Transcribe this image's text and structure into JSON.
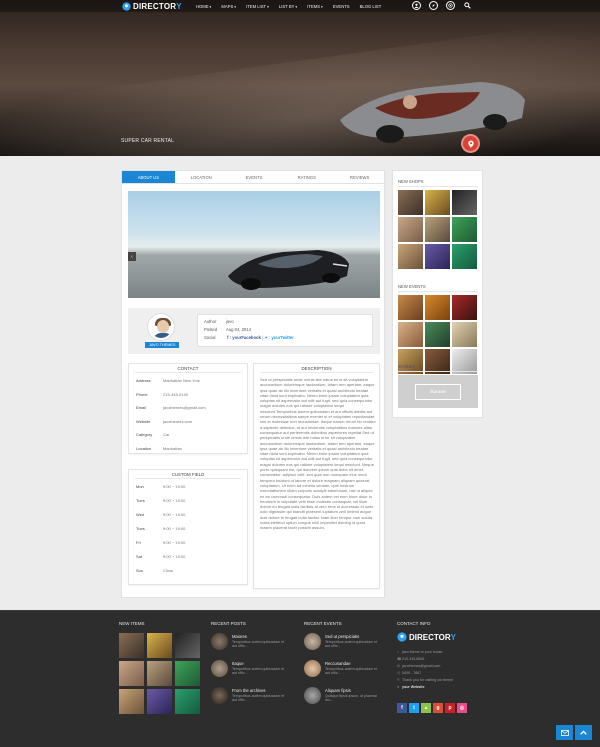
{
  "brand": {
    "name_main": "DIRECTOR",
    "name_accent": "Y"
  },
  "nav": [
    {
      "label": "HOME",
      "dropdown": true
    },
    {
      "label": "MAPS",
      "dropdown": true
    },
    {
      "label": "ITEM LIST",
      "dropdown": true
    },
    {
      "label": "LIST BY",
      "dropdown": true
    },
    {
      "label": "ITEMS",
      "dropdown": true
    },
    {
      "label": "EVENTS",
      "dropdown": false
    },
    {
      "label": "BLOG LIST",
      "dropdown": false
    }
  ],
  "hero": {
    "title": "SUPER CAR RENTAL"
  },
  "tabs": [
    "ABOUT US",
    "LOCATION",
    "EVENTS",
    "RATINGS",
    "REVIEWS"
  ],
  "author": {
    "badge": "JAVO THEMES",
    "rows": [
      {
        "k": "Author",
        "v": "javo"
      },
      {
        "k": "Posted",
        "v": "Aug 04, 2014"
      }
    ],
    "social_label": "Social",
    "facebook": "f : yourFacebook",
    "twitter": "yourTwitter",
    "twitter_prefix": " : "
  },
  "contact": {
    "title": "CONTACT",
    "rows": [
      {
        "k": "Address",
        "v": "Manhattan New York"
      },
      {
        "k": "Phone",
        "v": "215-345-0149"
      },
      {
        "k": "Email",
        "v": "javothemes@gmail.com"
      },
      {
        "k": "Website",
        "v": "javothemes.com"
      },
      {
        "k": "Category",
        "v": "Car"
      },
      {
        "k": "Location",
        "v": "Manhattan"
      }
    ]
  },
  "custom_field": {
    "title": "CUSTOM FIELD",
    "rows": [
      {
        "k": "Mon",
        "v": "9:00 ~ 19:00"
      },
      {
        "k": "Tues",
        "v": "9:00 ~ 19:00"
      },
      {
        "k": "Wed",
        "v": "9:00 ~ 19:00"
      },
      {
        "k": "Tues",
        "v": "9:00 ~ 19:00"
      },
      {
        "k": "Fri",
        "v": "9:00 ~ 19:00"
      },
      {
        "k": "Sat",
        "v": "9:00 ~ 19:00"
      },
      {
        "k": "Sun",
        "v": "Close"
      }
    ]
  },
  "description": {
    "title": "DESCRIPTION",
    "text": "Sed ut perspiciatis unde omnis iste natus error sit voluptatem accusantium doloremque laudantium, totam rem aperiam, eaque ipsa quae ab illo inventore veritatis et quasi architecto beatae vitae dicta sunt explicabo. Nemo enim ipsam voluptatem quia voluptas sit aspernatur aut odit aut fugit, sed quia consequuntur magni dolores eos qui ratione voluptatem sequi nesciunt.Temporibus autem quibusdam et aut officiis debitis aut rerum necessitatibus saepe eveniet ut et voluptates repudiandae sint et molestiae non recusandae. Itaque earum rerum hic tenetur a sapiente delectus, ut aut reiciendis voluptatibus maiores alias consequatur aut perferendis doloribus asperiores repellat.Sed ut perspiciatis unde omnis iste natus error sit voluptatem accusantium doloremque laudantium, totam rem aperiam, eaque ipsa quae ab illo inventore veritatis et quasi architecto beatae vitae dicta sunt explicabo. Nemo enim ipsam voluptatem quia voluptas sit aspernatur aut odit aut fugit, sed quia consequuntur magni dolores eos qui ratione voluptatem sequi nesciunt. Neque porro quisquam est, qui dolorem ipsum quia dolor sit amet, consectetur, adipisci velit, sed quia non numquam eius modi tempora incidunt ut labore et dolore magnam aliquam quaerat voluptatem. Ut enim ad minima veniam, quis nostrum exercitationem ullam corporis suscipit laboriosam, nisi ut aliquid ex ea commodi consequatur. Duis autem vel eum iriure dolor in hendrerit in vulputate velit esse molestie consequat, vel illum dolore eu feugiat nulla facilisis at vero eros et accumsan et iusto odio dignissim qui blandit praesent luptatum zzril delenit augue duis dolore te feugait nulla facilisi. Nam liber tempor cum soluta nobis eleifend option congue nihil imperdiet doming id quod mazim placerat facer possim assum."
  },
  "sidebar": {
    "shops_title": "NEW SHOPS",
    "events_title": "NEW EVENTS",
    "banner_title": "BANNER",
    "banner_label": "Banner"
  },
  "footer": {
    "new_items_title": "NEW ITEMS",
    "recent_posts_title": "RECENT POSTS",
    "recent_events_title": "RECENT EVENTS",
    "contact_title": "CONTACT INFO",
    "posts": [
      {
        "title": "Maiores",
        "sub": "Temporibus autem quibusdam et aut offic..."
      },
      {
        "title": "Itaque",
        "sub": "Temporibus autem quibusdam et aut offic..."
      },
      {
        "title": "From the archives",
        "sub": "Temporibus autem quibusdam et aut offic..."
      }
    ],
    "events": [
      {
        "title": "Sed ut perspiciatis",
        "sub": "Temporibus autem quibusdam et aut offic..."
      },
      {
        "title": "Reccusandae",
        "sub": "Temporibus autem quibusdam et aut offic..."
      },
      {
        "title": "Aliquam fipsis",
        "sub": "Quisque fipsis ipsum, ut placerat dui..."
      }
    ],
    "contact": {
      "address": "javo theme or your house",
      "phone": "215-345-8565",
      "email": "javothemes@gmail.com",
      "fax": "5409 - 7867",
      "note": "Thank you for visiting our theme",
      "website": "your Website"
    },
    "social": [
      {
        "name": "facebook-icon",
        "glyph": "f",
        "color": "#3b5998"
      },
      {
        "name": "twitter-icon",
        "glyph": "t",
        "color": "#1da1f2"
      },
      {
        "name": "android-icon",
        "glyph": "▲",
        "color": "#8bc34a"
      },
      {
        "name": "googleplus-icon",
        "glyph": "g",
        "color": "#dd4b39"
      },
      {
        "name": "pinterest-icon",
        "glyph": "p",
        "color": "#cb2027"
      },
      {
        "name": "dribbble-icon",
        "glyph": "◎",
        "color": "#ea4c89"
      }
    ]
  },
  "colors": {
    "accent": "#1a86d4",
    "brand_blue": "#2ea3f2",
    "hero_badge": "#d94336",
    "footer_bg": "#2d2d2d"
  }
}
